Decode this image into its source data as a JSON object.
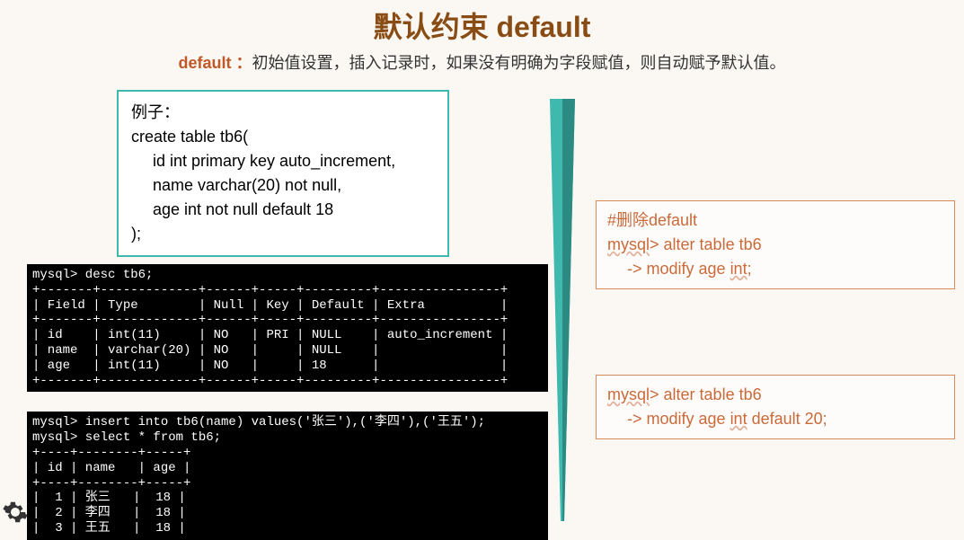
{
  "title": "默认约束  default",
  "subtitle_kw": "default ：",
  "subtitle_text": "初始值设置，插入记录时，如果没有明确为字段赋值，则自动赋予默认值。",
  "example": {
    "l1": "例子：",
    "l2": "create table tb6(",
    "l3": "id int primary key auto_increment,",
    "l4": "name varchar(20) not null,",
    "l5": "age int not null default 18",
    "l6": ");"
  },
  "terminal1": "mysql> desc tb6;\n+-------+-------------+------+-----+---------+----------------+\n| Field | Type        | Null | Key | Default | Extra          |\n+-------+-------------+------+-----+---------+----------------+\n| id    | int(11)     | NO   | PRI | NULL    | auto_increment |\n| name  | varchar(20) | NO   |     | NULL    |                |\n| age   | int(11)     | NO   |     | 18      |                |\n+-------+-------------+------+-----+---------+----------------+",
  "terminal2": "mysql> insert into tb6(name) values('张三'),('李四'),('王五');\nmysql> select * from tb6;\n+----+--------+-----+\n| id | name   | age |\n+----+--------+-----+\n|  1 | 张三   |  18 |\n|  2 | 李四   |  18 |\n|  3 | 王五   |  18 |",
  "note1": {
    "l1": "#删除default",
    "l2a": "mysql",
    "l2b": "> alter table tb6",
    "l3a": "-> modify age ",
    "l3b": "int",
    "l3c": ";"
  },
  "note2": {
    "l1a": "mysql",
    "l1b": "> alter table tb6",
    "l2a": "-> modify age ",
    "l2b": "int",
    "l2c": " default 20;"
  },
  "chart_data": {
    "type": "table",
    "tables": [
      {
        "title": "desc tb6",
        "columns": [
          "Field",
          "Type",
          "Null",
          "Key",
          "Default",
          "Extra"
        ],
        "rows": [
          [
            "id",
            "int(11)",
            "NO",
            "PRI",
            "NULL",
            "auto_increment"
          ],
          [
            "name",
            "varchar(20)",
            "NO",
            "",
            "NULL",
            ""
          ],
          [
            "age",
            "int(11)",
            "NO",
            "",
            "18",
            ""
          ]
        ]
      },
      {
        "title": "select * from tb6",
        "columns": [
          "id",
          "name",
          "age"
        ],
        "rows": [
          [
            1,
            "张三",
            18
          ],
          [
            2,
            "李四",
            18
          ],
          [
            3,
            "王五",
            18
          ]
        ]
      }
    ]
  }
}
